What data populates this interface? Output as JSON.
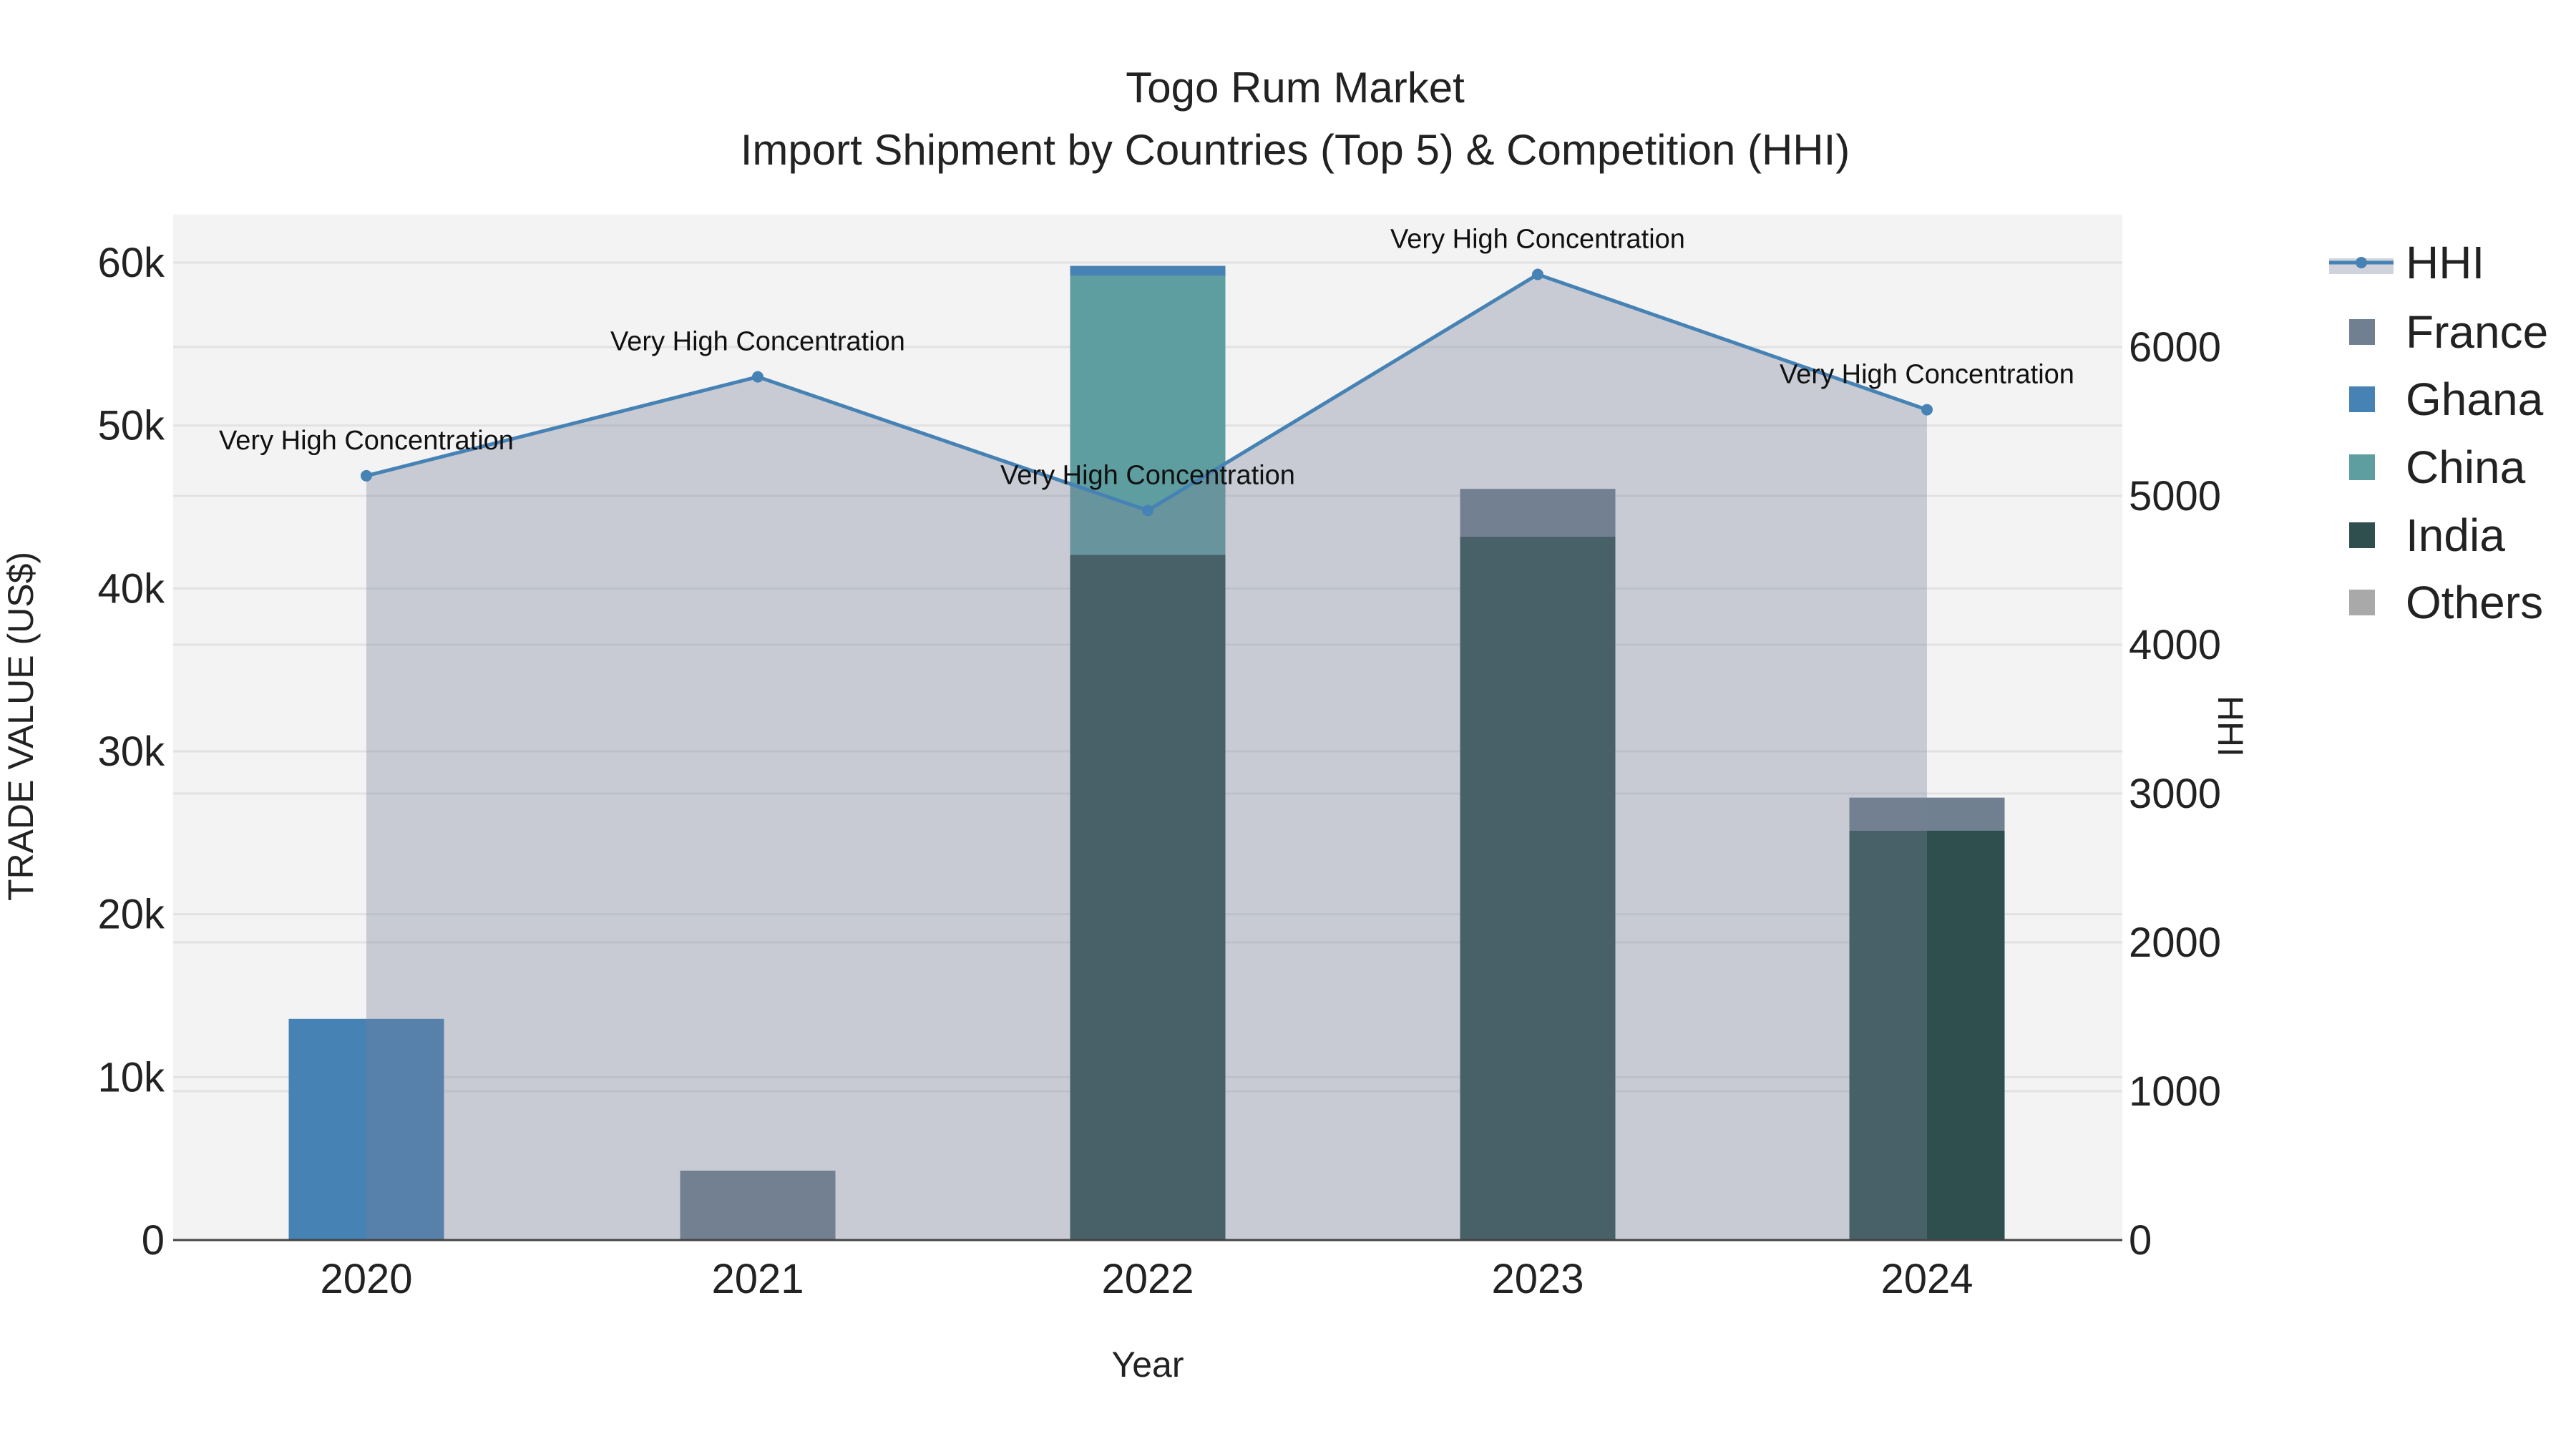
{
  "chart_data": {
    "type": "bar",
    "title": "Togo Rum Market",
    "subtitle": "Import Shipment by Countries (Top 5) & Competition (HHI)",
    "xlabel": "Year",
    "ylabel": "TRADE VALUE (US$)",
    "y2label": "HHI",
    "categories": [
      "2020",
      "2021",
      "2022",
      "2023",
      "2024"
    ],
    "ylim": [
      0,
      63000
    ],
    "y2lim": [
      0,
      6800
    ],
    "yticks": [
      0,
      10000,
      20000,
      30000,
      40000,
      50000,
      60000
    ],
    "ytick_labels": [
      "0",
      "10k",
      "20k",
      "30k",
      "40k",
      "50k",
      "60k"
    ],
    "y2ticks": [
      0,
      1000,
      2000,
      3000,
      4000,
      5000,
      6000
    ],
    "y2tick_labels": [
      "0",
      "1000",
      "2000",
      "3000",
      "4000",
      "5000",
      "6000"
    ],
    "grid": true,
    "legend_placement": "right",
    "series": [
      {
        "name": "India",
        "color": "#2f4f4f",
        "values": [
          0,
          0,
          42060,
          43180,
          25140
        ]
      },
      {
        "name": "China",
        "color": "#5f9ea0",
        "values": [
          0,
          0,
          17130,
          0,
          0
        ]
      },
      {
        "name": "Ghana",
        "color": "#4682b4",
        "values": [
          13580,
          0,
          610,
          0,
          0
        ]
      },
      {
        "name": "France",
        "color": "#708090",
        "values": [
          0,
          4260,
          0,
          2930,
          2020
        ]
      },
      {
        "name": "Others",
        "color": "#a9a9a9",
        "values": [
          0,
          0,
          0,
          0,
          0
        ]
      }
    ],
    "hhi": {
      "name": "HHI",
      "color": "#4682b4",
      "values": [
        5135,
        5800,
        4902,
        6488,
        5579
      ],
      "annotations": [
        "Very High Concentration",
        "Very High Concentration",
        "Very High Concentration",
        "Very High Concentration",
        "Very High Concentration"
      ]
    },
    "legend": [
      "HHI",
      "France",
      "Ghana",
      "China",
      "India",
      "Others"
    ]
  }
}
